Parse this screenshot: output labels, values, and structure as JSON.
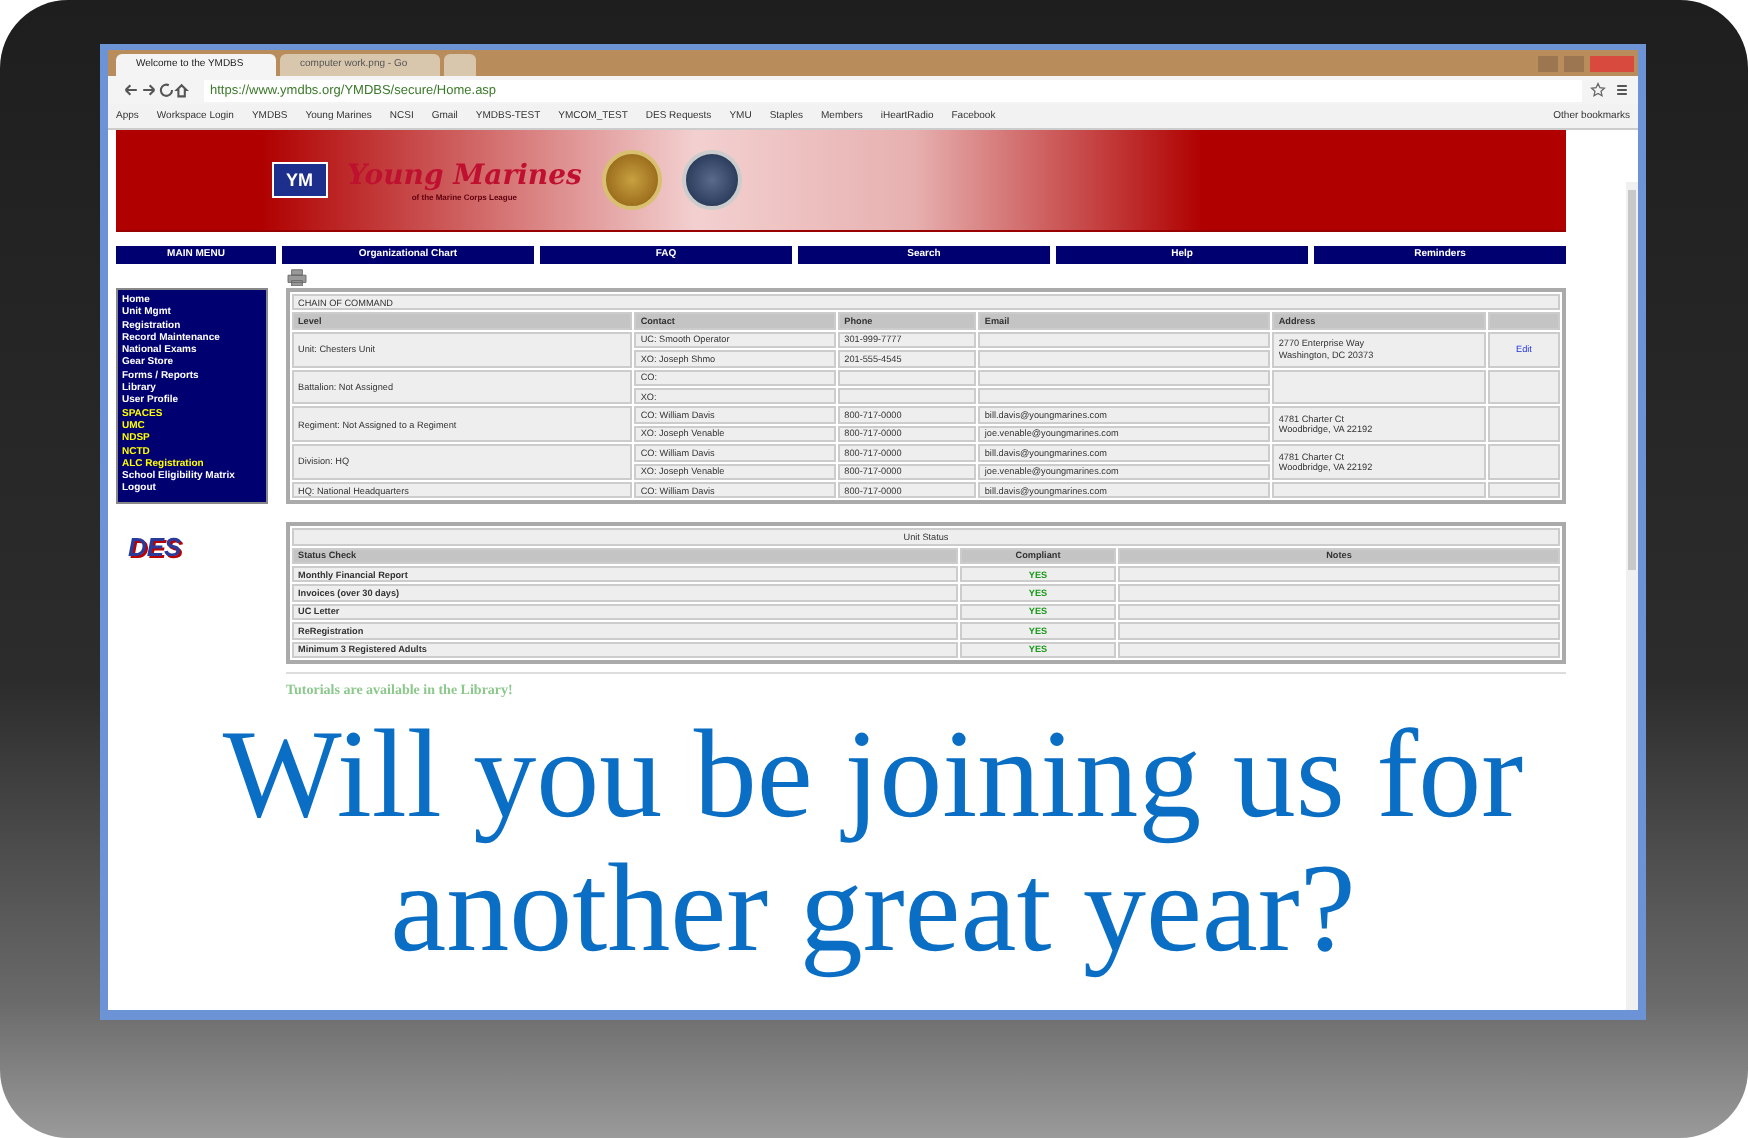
{
  "browser": {
    "tabs": [
      {
        "label": "Welcome to the YMDBS",
        "selected": true
      },
      {
        "label": "computer work.png - Go",
        "selected": false
      }
    ],
    "url": "https://www.ymdbs.org/YMDBS/secure/Home.asp",
    "bookmarks": [
      "Apps",
      "Workspace Login",
      "YMDBS",
      "Young Marines",
      "NCSI",
      "Gmail",
      "YMDBS-TEST",
      "YMCOM_TEST",
      "DES Requests",
      "YMU",
      "Staples",
      "Members",
      "iHeartRadio",
      "Facebook"
    ],
    "other_bookmarks": "Other bookmarks"
  },
  "banner": {
    "logo_badge": "YM",
    "logo_text": "Young Marines",
    "logo_subtitle": "of the Marine Corps League"
  },
  "nav": [
    "MAIN MENU",
    "Organizational Chart",
    "FAQ",
    "Search",
    "Help",
    "Reminders"
  ],
  "menu": [
    {
      "label": "Home",
      "color": "#ffffff"
    },
    {
      "label": "Unit Mgmt",
      "color": "#ffffff"
    },
    {
      "label": "Registration",
      "color": "#ffffff"
    },
    {
      "label": "Record Maintenance",
      "color": "#ffffff"
    },
    {
      "label": "National Exams",
      "color": "#ffffff"
    },
    {
      "label": "Gear Store",
      "color": "#ffffff"
    },
    {
      "label": "Forms / Reports",
      "color": "#ffffff"
    },
    {
      "label": "Library",
      "color": "#ffffff"
    },
    {
      "label": "User Profile",
      "color": "#ffffff"
    },
    {
      "label": "SPACES",
      "color": "#ffff00"
    },
    {
      "label": "UMC",
      "color": "#ffff00"
    },
    {
      "label": "NDSP",
      "color": "#ffff00"
    },
    {
      "label": "NCTD",
      "color": "#ffff00"
    },
    {
      "label": "ALC Registration",
      "color": "#ffff00"
    },
    {
      "label": "School Eligibility Matrix",
      "color": "#ffffff"
    },
    {
      "label": "Logout",
      "color": "#ffffff"
    }
  ],
  "des_logo": "DES",
  "chain": {
    "title": "CHAIN OF COMMAND",
    "columns": [
      "Level",
      "Contact",
      "Phone",
      "Email",
      "Address"
    ],
    "groups": [
      {
        "level": "Unit: Chesters Unit",
        "contacts": [
          {
            "contact": "UC: Smooth Operator",
            "phone": "301-999-7777"
          },
          {
            "contact": "XO: Joseph Shmo",
            "phone": "201-555-4545"
          }
        ],
        "address": [
          "2770 Enterprise Way",
          "Washington, DC 20373"
        ],
        "action": "Edit"
      },
      {
        "level": "Battalion: Not Assigned",
        "contacts": [
          {
            "contact": "CO:"
          },
          {
            "contact": "XO:"
          }
        ]
      },
      {
        "level": "Regiment: Not Assigned to a Regiment",
        "contacts": [
          {
            "contact": "CO: William Davis",
            "phone": "800-717-0000",
            "email": "bill.davis@youngmarines.com"
          },
          {
            "contact": "XO: Joseph Venable",
            "phone": "800-717-0000",
            "email": "joe.venable@youngmarines.com"
          }
        ],
        "address": [
          "4781 Charter Ct",
          "Woodbridge, VA 22192"
        ]
      },
      {
        "level": "Division: HQ",
        "contacts": [
          {
            "contact": "CO: William Davis",
            "phone": "800-717-0000",
            "email": "bill.davis@youngmarines.com"
          },
          {
            "contact": "XO: Joseph Venable",
            "phone": "800-717-0000",
            "email": "joe.venable@youngmarines.com"
          }
        ],
        "address": [
          "4781 Charter Ct",
          "Woodbridge, VA 22192"
        ]
      },
      {
        "level": "HQ: National Headquarters",
        "contacts": [
          {
            "contact": "CO: William Davis",
            "phone": "800-717-0000",
            "email": "bill.davis@youngmarines.com"
          }
        ]
      }
    ]
  },
  "status": {
    "title": "Unit Status",
    "columns": [
      "Status Check",
      "Compliant",
      "Notes"
    ],
    "rows": [
      {
        "check": "Monthly Financial Report",
        "compliant": "YES"
      },
      {
        "check": "Invoices (over 30 days)",
        "compliant": "YES"
      },
      {
        "check": "UC Letter",
        "compliant": "YES"
      },
      {
        "check": "ReRegistration",
        "compliant": "YES"
      },
      {
        "check": "Minimum 3 Registered Adults",
        "compliant": "YES"
      }
    ]
  },
  "news": {
    "heading": "Tutorials are available in the Library!"
  },
  "overlay": "Will you be joining us for another great year?"
}
